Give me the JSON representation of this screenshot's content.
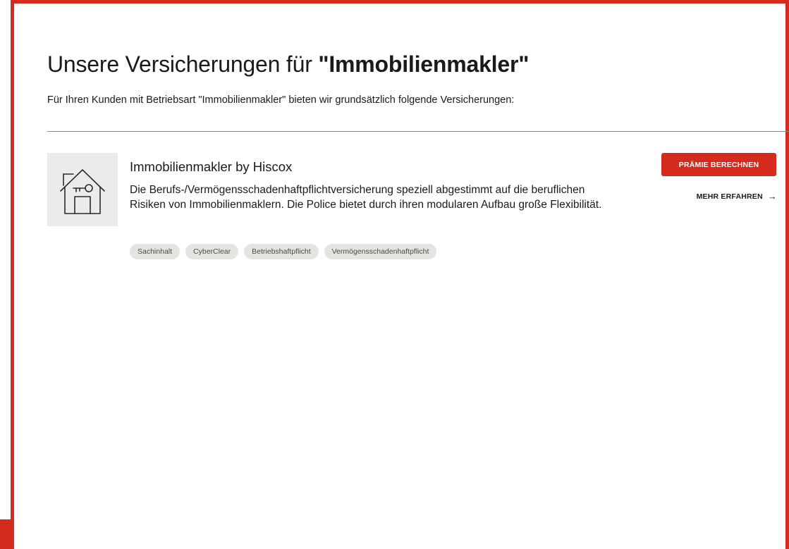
{
  "header": {
    "title_prefix": "Unsere Versicherungen für ",
    "title_strong": "\"Immobilienmakler\"",
    "intro": "Für Ihren Kunden mit Betriebsart \"Immobilienmakler\" bieten wir grundsätzlich folgende Versicherungen:"
  },
  "product": {
    "icon": "house-key-icon",
    "title": "Immobilienmakler by Hiscox",
    "description": "Die Berufs-/Vermögensschadenhaftpflichtversicherung speziell abgestimmt auf die beruflichen Risiken von Immobilienmaklern. Die Police bietet durch ihren mo­dularen Aufbau große Flexibilität.",
    "tags": [
      "Sachinhalt",
      "CyberClear",
      "Betriebshaftpflicht",
      "Vermögensschadenhaftpflicht"
    ],
    "primary_action": "PRÄMIE BERECHNEN",
    "secondary_action": "MEHR ERFAHREN",
    "secondary_action_icon": "arrow-right-icon"
  },
  "colors": {
    "accent": "#d52b1e",
    "tag_background": "#e6e4e0",
    "image_background": "#ecebe9"
  }
}
